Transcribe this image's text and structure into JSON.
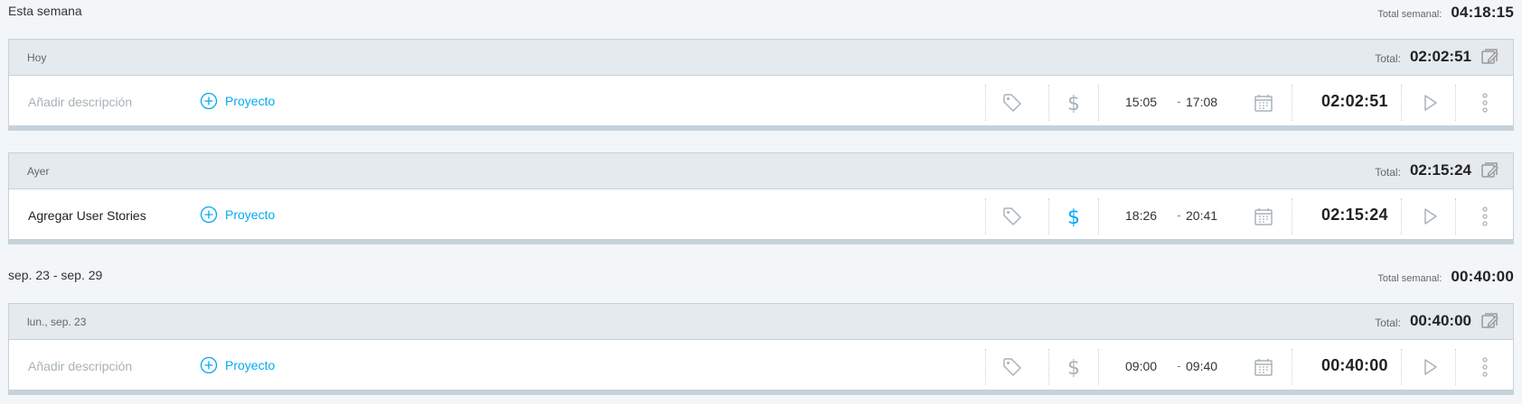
{
  "weeks": [
    {
      "label": "Esta semana",
      "total_label": "Total semanal:",
      "total": "04:18:15",
      "days": [
        {
          "label": "Hoy",
          "total_label": "Total:",
          "total": "02:02:51",
          "entry": {
            "description": "Añadir descripción",
            "description_is_placeholder": true,
            "project_label": "Proyecto",
            "billable": false,
            "start": "15:05",
            "end": "17:08",
            "duration": "02:02:51"
          }
        },
        {
          "label": "Ayer",
          "total_label": "Total:",
          "total": "02:15:24",
          "entry": {
            "description": "Agregar User Stories",
            "description_is_placeholder": false,
            "project_label": "Proyecto",
            "billable": true,
            "start": "18:26",
            "end": "20:41",
            "duration": "02:15:24"
          }
        }
      ]
    },
    {
      "label": "sep. 23 - sep. 29",
      "total_label": "Total semanal:",
      "total": "00:40:00",
      "days": [
        {
          "label": "lun., sep. 23",
          "total_label": "Total:",
          "total": "00:40:00",
          "entry": {
            "description": "Añadir descripción",
            "description_is_placeholder": true,
            "project_label": "Proyecto",
            "billable": false,
            "start": "09:00",
            "end": "09:40",
            "duration": "00:40:00"
          }
        }
      ]
    }
  ],
  "time_separator": "-",
  "colors": {
    "accent": "#03a9f4",
    "icon_gray": "#a8b2b8",
    "header_bg": "#e4eaee",
    "page_bg": "#f2f6f8"
  },
  "icons": {
    "bulk_edit": "bulk-edit-icon",
    "project_add": "plus-circle-icon",
    "tag": "tag-icon",
    "billable": "dollar-icon",
    "calendar": "calendar-icon",
    "play": "play-icon",
    "more": "more-vertical-icon"
  }
}
